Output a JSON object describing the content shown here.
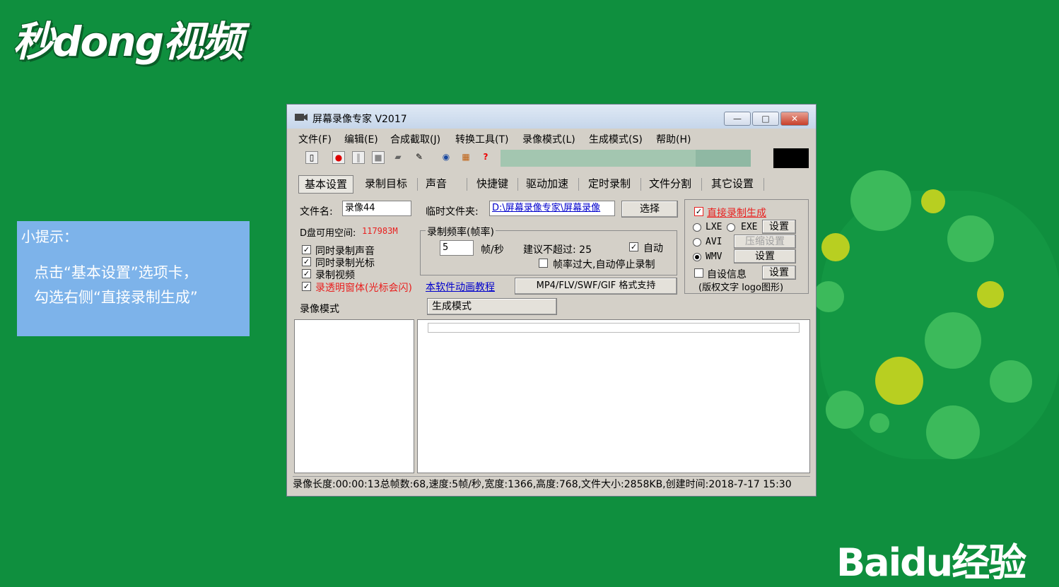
{
  "brand": {
    "logo": "秒dong视频",
    "watermark": "Baidu经验"
  },
  "tip": {
    "title": "小提示：",
    "line1": "点击“基本设置”选项卡，",
    "line2": "勾选右侧“直接录制生成”"
  },
  "window": {
    "title": "屏幕录像专家 V2017",
    "menu": [
      "文件(F)",
      "编辑(E)",
      "合成截取(J)",
      "转换工具(T)",
      "录像模式(L)",
      "生成模式(S)",
      "帮助(H)"
    ],
    "tabs": [
      "基本设置",
      "录制目标",
      "声音",
      "快捷键",
      "驱动加速",
      "定时录制",
      "文件分割",
      "其它设置"
    ],
    "active_tab": "基本设置",
    "progress": 0.78
  },
  "basic": {
    "filename_label": "文件名:",
    "filename_value": "录像44",
    "temp_folder_label": "临时文件夹:",
    "temp_folder_value": "D:\\屏幕录像专家\\屏幕录像",
    "choose_button": "选择",
    "disk_label": "D盘可用空间:",
    "disk_value": "117983M",
    "check_audio": "同时录制声音",
    "check_cursor": "同时录制光标",
    "check_video": "录制视频",
    "check_transparent": "录透明窗体(光标会闪)",
    "tutorial_link": "本软件动画教程",
    "format_button": "MP4/FLV/SWF/GIF  格式支持",
    "framerate_group": "录制频率(帧率)",
    "framerate_value": "5",
    "framerate_unit": "帧/秒",
    "suggest": "建议不超过: 25",
    "auto_label": "自动",
    "auto_stop_label": "帧率过大,自动停止录制"
  },
  "direct": {
    "checkbox_label": "直接录制生成",
    "lxe": "LXE",
    "exe": "EXE",
    "settings1": "设置",
    "avi": "AVI",
    "compress": "压缩设置",
    "wmv": "WMV",
    "settings2": "设置",
    "custom_info": "自设信息",
    "settings3": "设置",
    "custom_note": "(版权文字 logo图形)"
  },
  "lower": {
    "record_mode": "录像模式",
    "generate_mode": "生成模式"
  },
  "status_text": "录像长度:00:00:13总帧数:68,速度:5帧/秒,宽度:1366,高度:768,文件大小:2858KB,创建时间:2018-7-17 15:30",
  "colors": {
    "background": "#0f8f3e",
    "tip_box": "#7db3ea",
    "red_label": "#e8201f",
    "link": "#0000cc"
  },
  "icons": [
    "new-file-icon",
    "record-icon",
    "pause-icon",
    "stop-icon",
    "camera-icon",
    "pen-icon",
    "globe-icon",
    "calendar-icon",
    "help-icon",
    "minimize-icon",
    "maximize-icon",
    "close-icon"
  ]
}
